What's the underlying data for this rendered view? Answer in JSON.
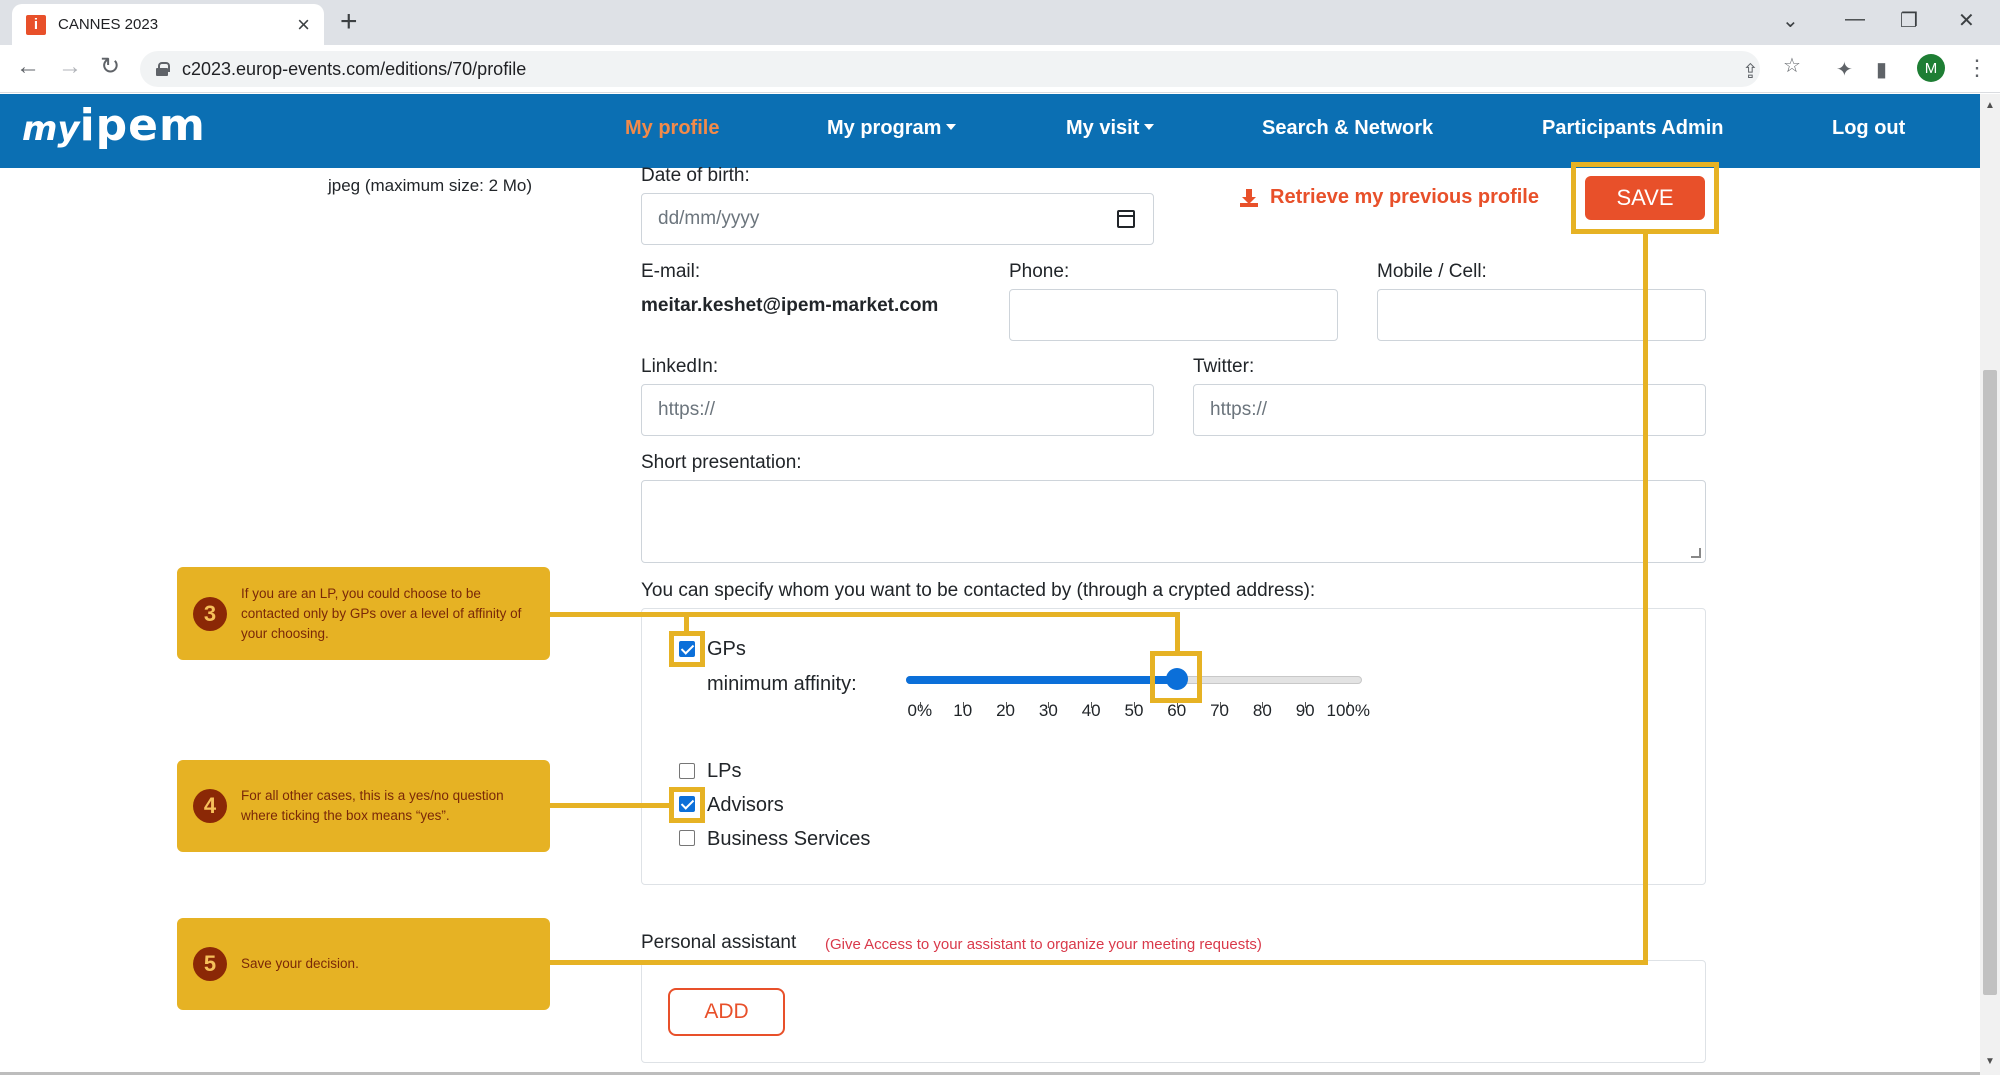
{
  "browser": {
    "tab_title": "CANNES 2023",
    "tab_favicon": "i",
    "url": "c2023.europ-events.com/editions/70/profile",
    "profile_initial": "M"
  },
  "nav": {
    "logo_my": "my",
    "logo_ipem": "ipem",
    "items": [
      "My profile",
      "My program",
      "My visit",
      "Search & Network",
      "Participants Admin",
      "Log out"
    ],
    "active_color": "#f28a4a",
    "bar_color": "#0b6fb3"
  },
  "form": {
    "photo_hint": "jpeg (maximum size: 2 Mo)",
    "dob_label": "Date of birth:",
    "dob_placeholder": "dd/mm/yyyy",
    "retrieve_label": "Retrieve my previous profile",
    "save_label": "SAVE",
    "email_label": "E-mail:",
    "email_value": "meitar.keshet@ipem-market.com",
    "phone_label": "Phone:",
    "mobile_label": "Mobile / Cell:",
    "linkedin_label": "LinkedIn:",
    "linkedin_placeholder": "https://",
    "twitter_label": "Twitter:",
    "twitter_placeholder": "https://",
    "presentation_label": "Short presentation:",
    "contact_label": "You can specify whom you want to be contacted by (through a crypted address):",
    "options": [
      {
        "label": "GPs",
        "checked": true
      },
      {
        "label": "LPs",
        "checked": false
      },
      {
        "label": "Advisors",
        "checked": true
      },
      {
        "label": "Business Services",
        "checked": false
      }
    ],
    "affinity_label": "minimum affinity:",
    "affinity_value": 60,
    "affinity_ticks": [
      "0%",
      "10",
      "20",
      "30",
      "40",
      "50",
      "60",
      "70",
      "80",
      "90",
      "100%"
    ],
    "assistant_label": "Personal assistant",
    "assistant_note": "(Give Access to your assistant to organize your meeting requests)",
    "add_label": "ADD"
  },
  "annotations": [
    {
      "num": "3",
      "text": "If you are an LP, you could choose to be contacted only by GPs  over a level of affinity of your choosing."
    },
    {
      "num": "4",
      "text": "For all other cases, this is a yes/no question where ticking the box means “yes”."
    },
    {
      "num": "5",
      "text": "Save your decision."
    }
  ],
  "colors": {
    "accent": "#e8502a",
    "highlight": "#e6b224",
    "checkbox": "#0b6fd9"
  }
}
